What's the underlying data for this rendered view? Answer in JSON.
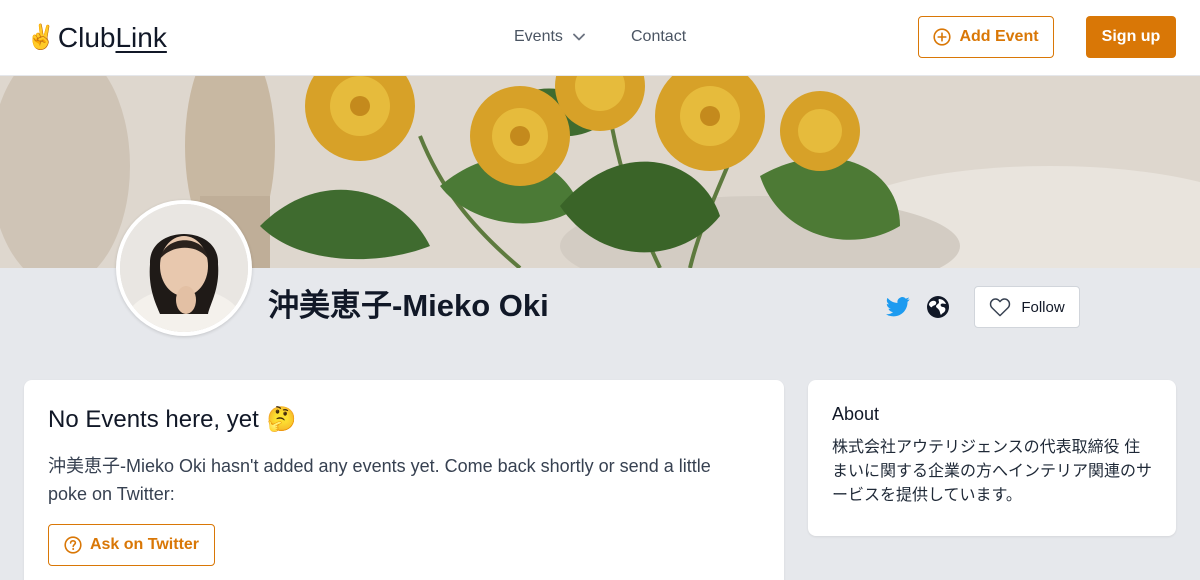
{
  "brand": {
    "logo_emoji": "✌️",
    "logo_text_a": "Club",
    "logo_text_b": "Link"
  },
  "nav": {
    "events_label": "Events",
    "contact_label": "Contact",
    "add_event_label": "Add Event",
    "signup_label": "Sign up"
  },
  "profile": {
    "name": "沖美恵子-Mieko Oki",
    "follow_label": "Follow"
  },
  "events_card": {
    "title": "No Events here, yet",
    "title_emoji": "🤔",
    "body": "沖美恵子-Mieko Oki hasn't added any events yet. Come back shortly or send a little poke on Twitter:",
    "ask_button_label": "Ask on Twitter"
  },
  "about_card": {
    "title": "About",
    "text": "株式会社アウテリジェンスの代表取締役 住まいに関する企業の方へインテリア関連のサービスを提供しています。"
  },
  "colors": {
    "accent": "#d97706",
    "twitter": "#1d9bf0",
    "page_bg": "#e6e8ec"
  },
  "icons": {
    "chevron": "chevron-down-icon",
    "add": "plus-circle-icon",
    "twitter": "twitter-icon",
    "globe": "globe-icon",
    "heart": "heart-icon",
    "help": "question-circle-icon"
  }
}
